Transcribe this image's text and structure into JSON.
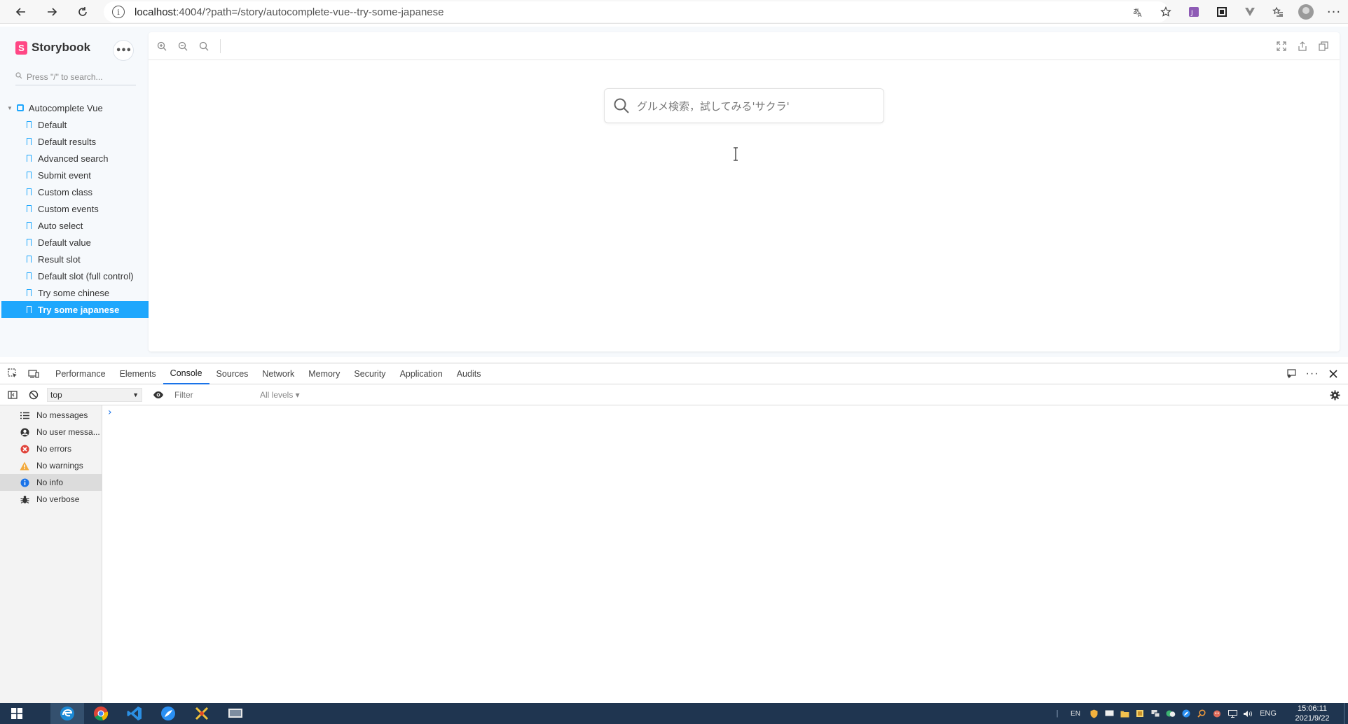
{
  "browser": {
    "url_host": "localhost",
    "url_rest": ":4004/?path=/story/autocomplete-vue--try-some-japanese"
  },
  "storybook": {
    "brand": "Storybook",
    "search_placeholder": "Press \"/\" to search...",
    "component": "Autocomplete Vue",
    "stories": [
      {
        "label": "Default"
      },
      {
        "label": "Default results"
      },
      {
        "label": "Advanced search"
      },
      {
        "label": "Submit event"
      },
      {
        "label": "Custom class"
      },
      {
        "label": "Custom events"
      },
      {
        "label": "Auto select"
      },
      {
        "label": "Default value"
      },
      {
        "label": "Result slot"
      },
      {
        "label": "Default slot (full control)"
      },
      {
        "label": "Try some chinese"
      },
      {
        "label": "Try some japanese"
      }
    ],
    "active_story": "Try some japanese",
    "accent": "#1ea7fd",
    "brand_color": "#ff4785"
  },
  "preview": {
    "autocomplete_placeholder": "グルメ検索，試してみる'サクラ'"
  },
  "devtools": {
    "tabs": [
      {
        "label": "Performance"
      },
      {
        "label": "Elements"
      },
      {
        "label": "Console"
      },
      {
        "label": "Sources"
      },
      {
        "label": "Network"
      },
      {
        "label": "Memory"
      },
      {
        "label": "Security"
      },
      {
        "label": "Application"
      },
      {
        "label": "Audits"
      }
    ],
    "active_tab": "Console",
    "context": "top",
    "filter_placeholder": "Filter",
    "levels": "All levels ▾",
    "sidebar": [
      {
        "label": "No messages",
        "icon": "list-icon"
      },
      {
        "label": "No user messa...",
        "icon": "user-icon"
      },
      {
        "label": "No errors",
        "icon": "error-icon"
      },
      {
        "label": "No warnings",
        "icon": "warning-icon"
      },
      {
        "label": "No info",
        "icon": "info-icon"
      },
      {
        "label": "No verbose",
        "icon": "bug-icon"
      }
    ],
    "active_filter": "No info"
  },
  "taskbar": {
    "lang_short": "EN",
    "lang": "ENG",
    "time": "15:06:11",
    "date": "2021/9/22"
  }
}
